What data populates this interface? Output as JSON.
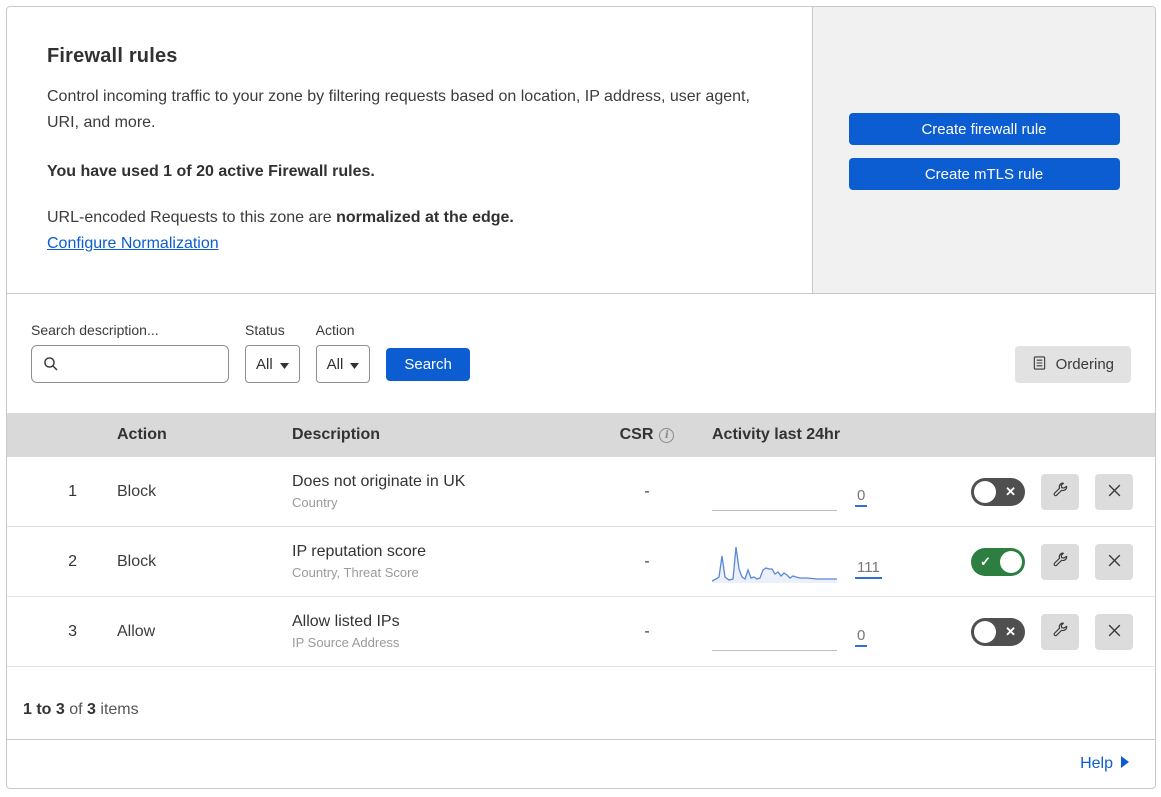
{
  "header": {
    "title": "Firewall rules",
    "description": "Control incoming traffic to your zone by filtering requests based on location, IP address, user agent, URI, and more.",
    "usage_line": "You have used 1 of 20 active Firewall rules.",
    "normalization_prefix": "URL-encoded Requests to this zone are ",
    "normalization_bold": "normalized at the edge.",
    "normalization_link": "Configure Normalization",
    "buttons": [
      {
        "label": "Create firewall rule"
      },
      {
        "label": "Create mTLS rule"
      }
    ]
  },
  "filters": {
    "search_label": "Search description...",
    "status_label": "Status",
    "status_value": "All",
    "action_label": "Action",
    "action_value": "All",
    "search_button": "Search",
    "ordering_button": "Ordering"
  },
  "table": {
    "columns": {
      "action": "Action",
      "description": "Description",
      "csr": "CSR",
      "activity": "Activity last 24hr"
    },
    "rows": [
      {
        "priority": "1",
        "action": "Block",
        "description": "Does not originate in UK",
        "criteria": "Country",
        "csr": "-",
        "activity_count": "0",
        "enabled": false,
        "has_sparkline": false
      },
      {
        "priority": "2",
        "action": "Block",
        "description": "IP reputation score",
        "criteria": "Country, Threat Score",
        "csr": "-",
        "activity_count": "111",
        "enabled": true,
        "has_sparkline": true
      },
      {
        "priority": "3",
        "action": "Allow",
        "description": "Allow listed IPs",
        "criteria": "IP Source Address",
        "csr": "-",
        "activity_count": "0",
        "enabled": false,
        "has_sparkline": false
      }
    ]
  },
  "footer": {
    "range_bold": "1 to 3",
    "of_text": " of ",
    "total_bold": "3",
    "items_text": " items",
    "help_label": "Help"
  },
  "icons": {
    "toggle_on_glyph": "✓",
    "toggle_off_glyph": "✕"
  },
  "colors": {
    "accent_blue": "#0b5dd1",
    "toggle_on_green": "#2d7e41",
    "toggle_off_gray": "#4f4f4f",
    "sparkline_blue": "#5b87d7",
    "panel_gray": "#f1f1f1",
    "table_header_gray": "#d9d9d9"
  }
}
